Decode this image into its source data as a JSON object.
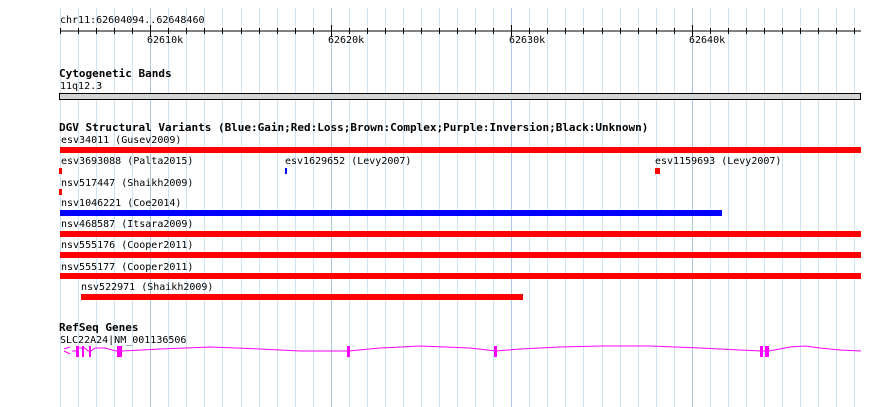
{
  "ruler": {
    "locus": "chr11:62604094..62648460",
    "ticks": [
      "62610k",
      "62620k",
      "62630k",
      "62640k"
    ]
  },
  "cytogenetic": {
    "title": "Cytogenetic Bands",
    "band": "11q12.3"
  },
  "dgv": {
    "title": "DGV Structural Variants (Blue:Gain;Red:Loss;Brown:Complex;Purple:Inversion;Black:Unknown)",
    "variants": [
      {
        "label": "esv34011 (Gusev2009)",
        "type": "loss"
      },
      {
        "label": "esv3693088 (Palta2015)",
        "type": "loss"
      },
      {
        "label": "esv1629652 (Levy2007)",
        "type": "gain"
      },
      {
        "label": "esv1159693 (Levy2007)",
        "type": "loss"
      },
      {
        "label": "nsv517447 (Shaikh2009)",
        "type": "loss"
      },
      {
        "label": "nsv1046221 (Coe2014)",
        "type": "gain"
      },
      {
        "label": "nsv468587 (Itsara2009)",
        "type": "loss"
      },
      {
        "label": "nsv555176 (Cooper2011)",
        "type": "loss"
      },
      {
        "label": "nsv555177 (Cooper2011)",
        "type": "loss"
      },
      {
        "label": "nsv522971 (Shaikh2009)",
        "type": "loss"
      }
    ],
    "colors": {
      "gain": "#0000ff",
      "loss": "#ff0000"
    }
  },
  "refseq": {
    "title": "RefSeq Genes",
    "gene": "SLC22A24|NM_001136506",
    "color": "#ff00ff"
  }
}
